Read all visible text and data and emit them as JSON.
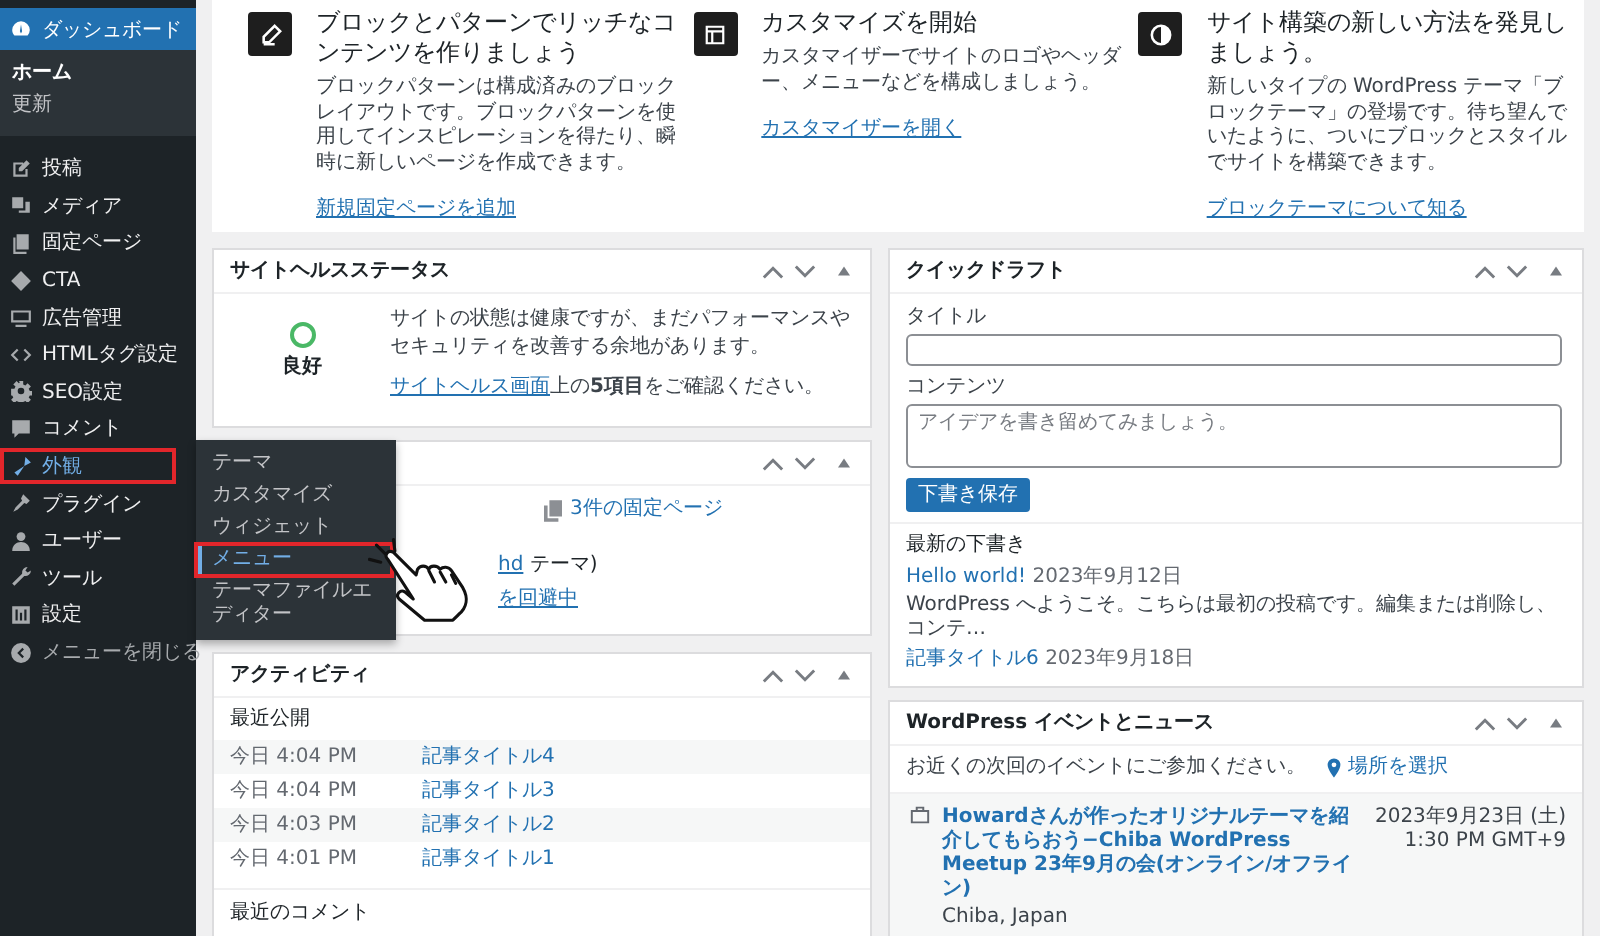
{
  "sidebar": {
    "items": [
      {
        "label": "ダッシュボード",
        "selected": true,
        "hovered": false,
        "annotated": false,
        "children": [
          {
            "label": "ホーム",
            "selected": true
          },
          {
            "label": "更新",
            "selected": false
          }
        ]
      },
      {
        "label": "投稿",
        "selected": false,
        "hovered": false,
        "annotated": false
      },
      {
        "label": "メディア",
        "selected": false,
        "hovered": false,
        "annotated": false
      },
      {
        "label": "固定ページ",
        "selected": false,
        "hovered": false,
        "annotated": false
      },
      {
        "label": "CTA",
        "selected": false,
        "hovered": false,
        "annotated": false
      },
      {
        "label": "広告管理",
        "selected": false,
        "hovered": false,
        "annotated": false
      },
      {
        "label": "HTMLタグ設定",
        "selected": false,
        "hovered": false,
        "annotated": false
      },
      {
        "label": "SEO設定",
        "selected": false,
        "hovered": false,
        "annotated": false
      },
      {
        "label": "コメント",
        "selected": false,
        "hovered": false,
        "annotated": false
      },
      {
        "label": "外観",
        "selected": false,
        "hovered": true,
        "annotated": true
      },
      {
        "label": "プラグイン",
        "selected": false,
        "hovered": false,
        "annotated": false
      },
      {
        "label": "ユーザー",
        "selected": false,
        "hovered": false,
        "annotated": false
      },
      {
        "label": "ツール",
        "selected": false,
        "hovered": false,
        "annotated": false
      },
      {
        "label": "設定",
        "selected": false,
        "hovered": false,
        "annotated": false
      },
      {
        "label": "メニューを閉じる",
        "selected": false,
        "hovered": false,
        "annotated": false
      }
    ]
  },
  "flyout": {
    "items": [
      {
        "label": "テーマ",
        "selected": false,
        "annotated": false
      },
      {
        "label": "カスタマイズ",
        "selected": false,
        "annotated": false
      },
      {
        "label": "ウィジェット",
        "selected": false,
        "annotated": false
      },
      {
        "label": "メニュー",
        "selected": true,
        "annotated": true
      },
      {
        "label": "テーマファイルエディター",
        "selected": false,
        "annotated": false
      }
    ]
  },
  "welcome": {
    "columns": [
      {
        "heading": "ブロックとパターンでリッチなコンテンツを作りましょう",
        "text": "ブロックパターンは構成済みのブロックレイアウトです。ブロックパターンを使用してインスピレーションを得たり、瞬時に新しいページを作成できます。",
        "link": "新規固定ページを追加"
      },
      {
        "heading": "カスタマイズを開始",
        "text": "カスタマイザーでサイトのロゴやヘッダー、メニューなどを構成しましょう。",
        "link": "カスタマイザーを開く"
      },
      {
        "heading": "サイト構築の新しい方法を発見しましょう。",
        "text": "新しいタイプの WordPress テーマ「ブロックテーマ」の登場です。待ち望んでいたように、ついにブロックとスタイルでサイトを構築できます。",
        "link": "ブロックテーマについて知る"
      }
    ]
  },
  "site_health": {
    "title": "サイトヘルスステータス",
    "status": "良好",
    "message": "サイトの状態は健康ですが、まだパフォーマンスやセキュリティを改善する余地があります。",
    "note_link": "サイトヘルス画面",
    "note": "上の**5項目**をご確認ください。"
  },
  "glance": {
    "pages_link": "3件の固定ページ",
    "theme_link": "hd",
    "theme_text": "テーマ)",
    "search_link": "を回避中"
  },
  "activity": {
    "title": "アクティビティ",
    "section": "最近公開",
    "rows": [
      {
        "date": "今日 4:04 PM",
        "title": "記事タイトル4"
      },
      {
        "date": "今日 4:04 PM",
        "title": "記事タイトル3"
      },
      {
        "date": "今日 4:03 PM",
        "title": "記事タイトル2"
      },
      {
        "date": "今日 4:01 PM",
        "title": "記事タイトル1"
      }
    ],
    "comments_heading": "最近のコメント"
  },
  "quick_draft": {
    "title": "クイックドラフト",
    "title_field": {
      "label": "タイトル"
    },
    "content_field": {
      "label": "コンテンツ",
      "placeholder": "アイデアを書き留めてみましょう。"
    },
    "save_button": "下書き保存",
    "drafts_heading": "最新の下書き",
    "drafts": [
      {
        "title": "Hello world!",
        "date": "2023年9月12日",
        "excerpt": "WordPress へようこそ。こちらは最初の投稿です。編集または削除し、コンテ…"
      },
      {
        "title": "記事タイトル6",
        "date": "2023年9月18日"
      }
    ]
  },
  "events": {
    "title": "WordPress イベントとニュース",
    "prompt": "お近くの次回のイベントにご参加ください。",
    "location_link": "場所を選択",
    "items": [
      {
        "title": "Howardさんが作ったオリジナルテーマを紹介してもらおう−Chiba WordPress Meetup 23年9月の会(オンライン/オフライン)",
        "place": "Chiba, Japan",
        "date": "2023年9月23日 (土)",
        "time": "1:30 PM GMT+9"
      }
    ]
  }
}
